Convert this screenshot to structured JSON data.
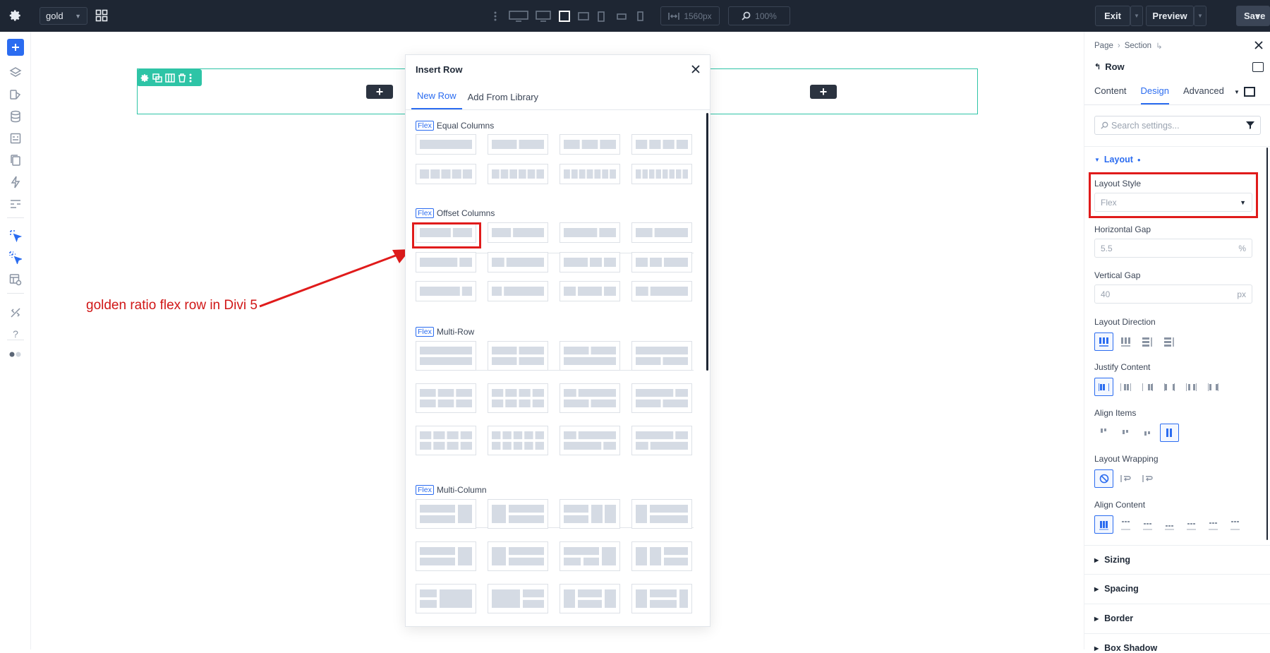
{
  "topbar": {
    "preset_label": "gold",
    "width_value": "1560px",
    "zoom_value": "100%",
    "exit_label": "Exit",
    "preview_label": "Preview",
    "save_label": "Save"
  },
  "modal": {
    "title": "Insert Row",
    "tabs": [
      "New Row",
      "Add From Library"
    ],
    "flex_badge": "Flex",
    "sections": [
      "Equal Columns",
      "Offset Columns",
      "Multi-Row",
      "Multi-Column"
    ]
  },
  "annotation": {
    "text": "golden ratio flex row in Divi 5",
    "color": "#e01b1b"
  },
  "panel": {
    "breadcrumb": [
      "Page",
      "Section"
    ],
    "title": "Row",
    "tabs": [
      "Content",
      "Design",
      "Advanced"
    ],
    "search_placeholder": "Search settings...",
    "group_title": "Layout",
    "layout_style_label": "Layout Style",
    "layout_style_value": "Flex",
    "horizontal_gap_label": "Horizontal Gap",
    "horizontal_gap_value": "5.5",
    "horizontal_gap_unit": "%",
    "vertical_gap_label": "Vertical Gap",
    "vertical_gap_value": "40",
    "vertical_gap_unit": "px",
    "layout_direction_label": "Layout Direction",
    "justify_content_label": "Justify Content",
    "align_items_label": "Align Items",
    "layout_wrapping_label": "Layout Wrapping",
    "align_content_label": "Align Content",
    "collapsed_groups": [
      "Sizing",
      "Spacing",
      "Border",
      "Box Shadow"
    ]
  },
  "colors": {
    "accent": "#2b6cf0",
    "topbar": "#1e2633",
    "row_outline": "#2ec4a6"
  }
}
